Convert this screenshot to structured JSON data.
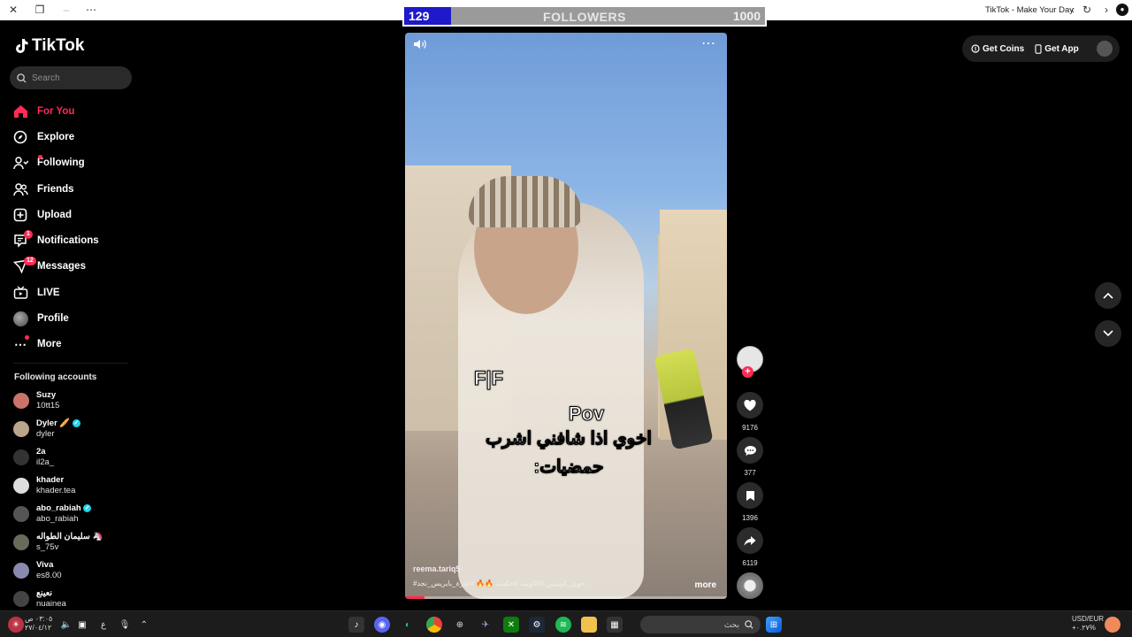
{
  "window": {
    "title": "TikTok - Make Your Day"
  },
  "followers_bar": {
    "current": "129",
    "label": "FOLLOWERS",
    "goal": "1000",
    "progress_fraction": 0.129
  },
  "brand": {
    "name": "TikTok",
    "accent": "#fe2c55"
  },
  "search": {
    "placeholder": "Search"
  },
  "nav": {
    "items": [
      {
        "label": "For You",
        "icon": "home-icon",
        "active": true
      },
      {
        "label": "Explore",
        "icon": "compass-icon"
      },
      {
        "label": "Following",
        "icon": "following-icon"
      },
      {
        "label": "Friends",
        "icon": "friends-icon"
      },
      {
        "label": "Upload",
        "icon": "upload-icon"
      },
      {
        "label": "Notifications",
        "icon": "inbox-icon",
        "badge": "1"
      },
      {
        "label": "Messages",
        "icon": "send-icon",
        "badge": "12"
      },
      {
        "label": "LIVE",
        "icon": "live-tv-icon"
      },
      {
        "label": "Profile",
        "icon": "avatar-icon"
      },
      {
        "label": "More",
        "icon": "more-dots-icon"
      }
    ]
  },
  "following": {
    "header": "Following accounts",
    "accounts": [
      {
        "name": "Suzy",
        "handle": "10tt15"
      },
      {
        "name": "Dyler 🥖",
        "handle": "dyler",
        "verified": true
      },
      {
        "name": "2a",
        "handle": "il2a_"
      },
      {
        "name": "khader",
        "handle": "khader.tea"
      },
      {
        "name": "abo_rabiah",
        "handle": "abo_rabiah",
        "verified": true
      },
      {
        "name": "سليمان الطواله 🦄",
        "handle": "s_75v"
      },
      {
        "name": "Viva",
        "handle": "es8.00"
      },
      {
        "name": "نعينع",
        "handle": "nuainea"
      }
    ]
  },
  "video": {
    "overlay_text_1": "F|F",
    "overlay_text_2": "Pov",
    "caption_line_1": "اخوي اذا شافني اشرب",
    "caption_line_2": "حمضيات:",
    "author": "reema.tariq5",
    "hashtags": "#حوى_كويتيين #الكويت #حكيمه 🔥🔥 #عنزة_بابريس_نجد ...",
    "more_label": "more",
    "progress_fraction": 0.06
  },
  "actions": {
    "likes": "9176",
    "comments": "377",
    "saves": "1396",
    "shares": "6119"
  },
  "topbar": {
    "get_coins": "Get Coins",
    "get_app": "Get App"
  },
  "taskbar": {
    "clock_time": "٠٣:٠٥ ص",
    "clock_date": "٢٧/٠٤/١٢",
    "search_label": "بحث",
    "fx_label": "USD/EUR",
    "fx_value": "+٠.٢٧%",
    "lang": "ع"
  }
}
